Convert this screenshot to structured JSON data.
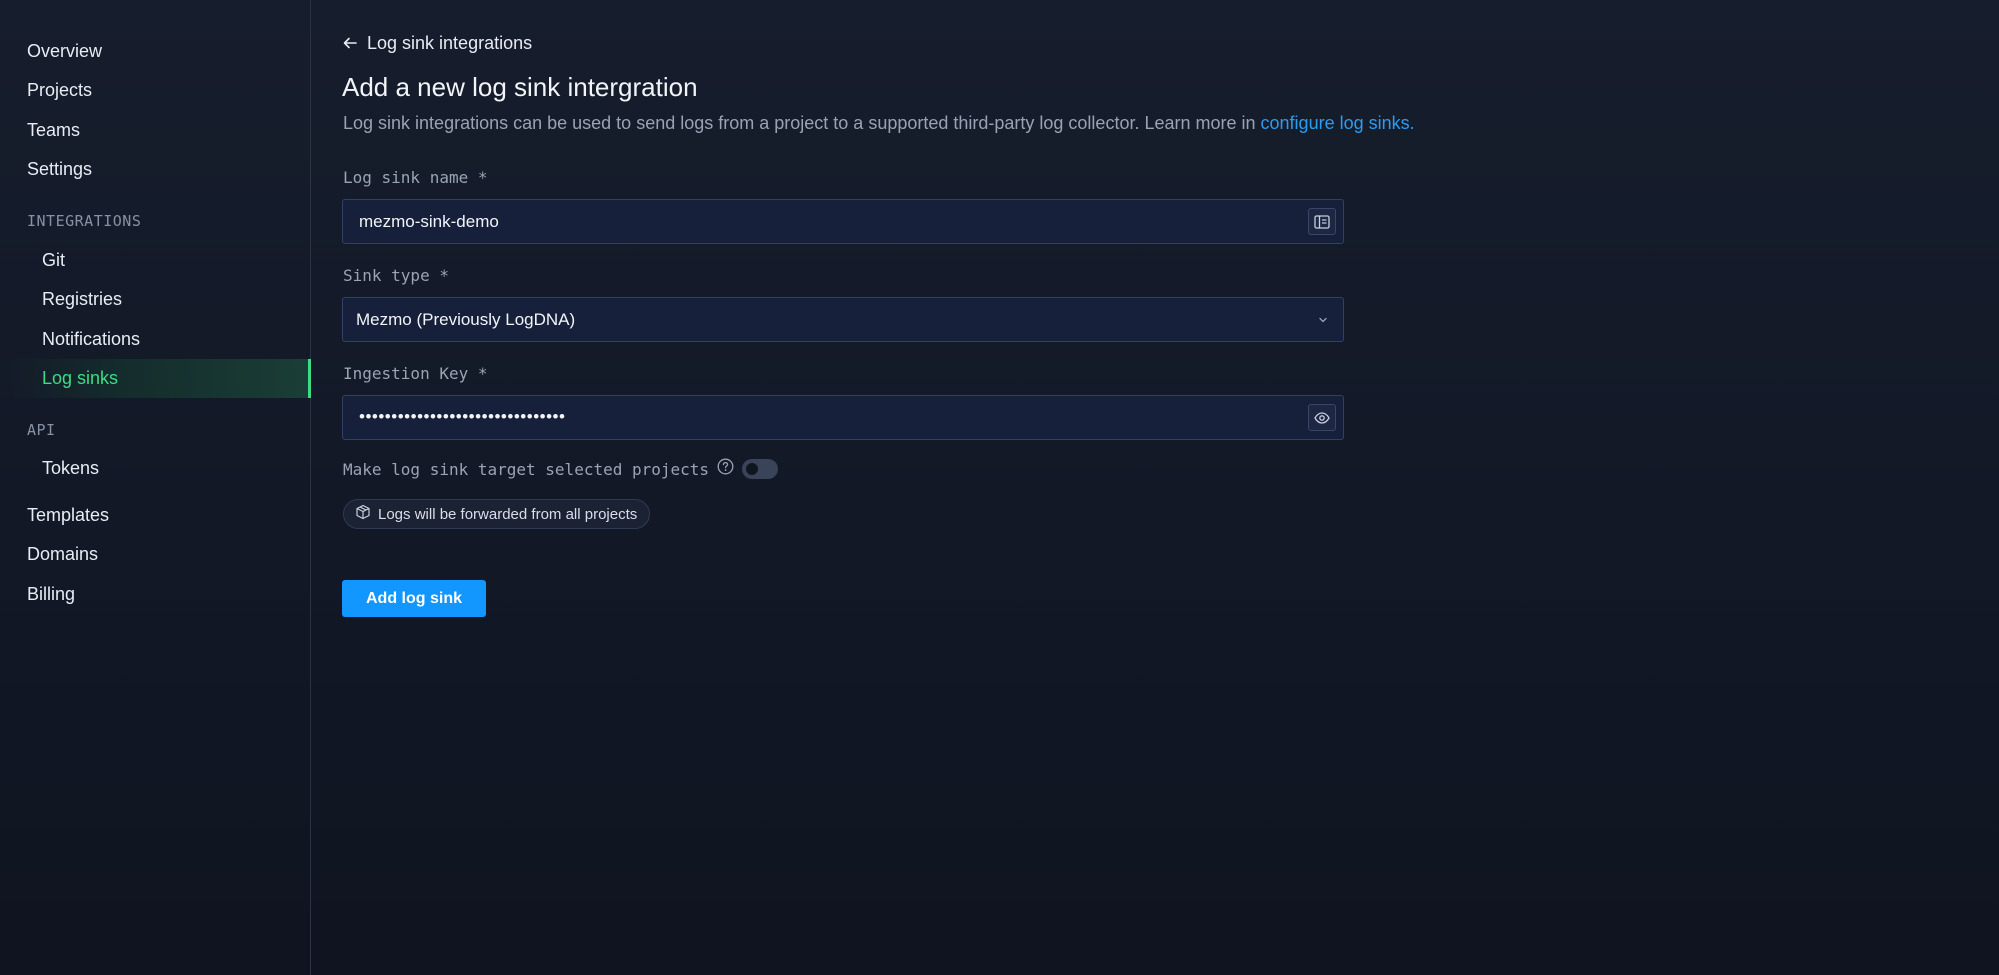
{
  "sidebar": {
    "items_top": [
      {
        "label": "Overview"
      },
      {
        "label": "Projects"
      },
      {
        "label": "Teams"
      },
      {
        "label": "Settings"
      }
    ],
    "integrations_heading": "INTEGRATIONS",
    "integrations": [
      {
        "label": "Git"
      },
      {
        "label": "Registries"
      },
      {
        "label": "Notifications"
      },
      {
        "label": "Log sinks",
        "active": true
      }
    ],
    "api_heading": "API",
    "api": [
      {
        "label": "Tokens"
      }
    ],
    "items_bottom": [
      {
        "label": "Templates"
      },
      {
        "label": "Domains"
      },
      {
        "label": "Billing"
      }
    ],
    "active_color": "#3ddc84"
  },
  "header": {
    "back_label": "Log sink integrations",
    "title": "Add a new log sink intergration",
    "description": "Log sink integrations can be used to send logs from a project to a supported third-party log collector. Learn more in",
    "description_link": "configure log sinks."
  },
  "form": {
    "name": {
      "label": "Log sink name *",
      "value": "mezmo-sink-demo",
      "icon": "id-card-icon"
    },
    "sink_type": {
      "label": "Sink type *",
      "value": "Mezmo (Previously LogDNA)",
      "icon": "chevron-down-icon"
    },
    "ingestion_key": {
      "label": "Ingestion Key *",
      "value": "••••••••••••••••••••••••••••••••",
      "icon": "eye-icon"
    },
    "target_toggle": {
      "label": "Make log sink target selected projects",
      "enabled": false
    },
    "info_pill": "Logs will be forwarded from all projects",
    "submit_label": "Add log sink"
  },
  "colors": {
    "accent": "#1296ff",
    "link": "#2d9bf0",
    "background": "#131a28"
  }
}
